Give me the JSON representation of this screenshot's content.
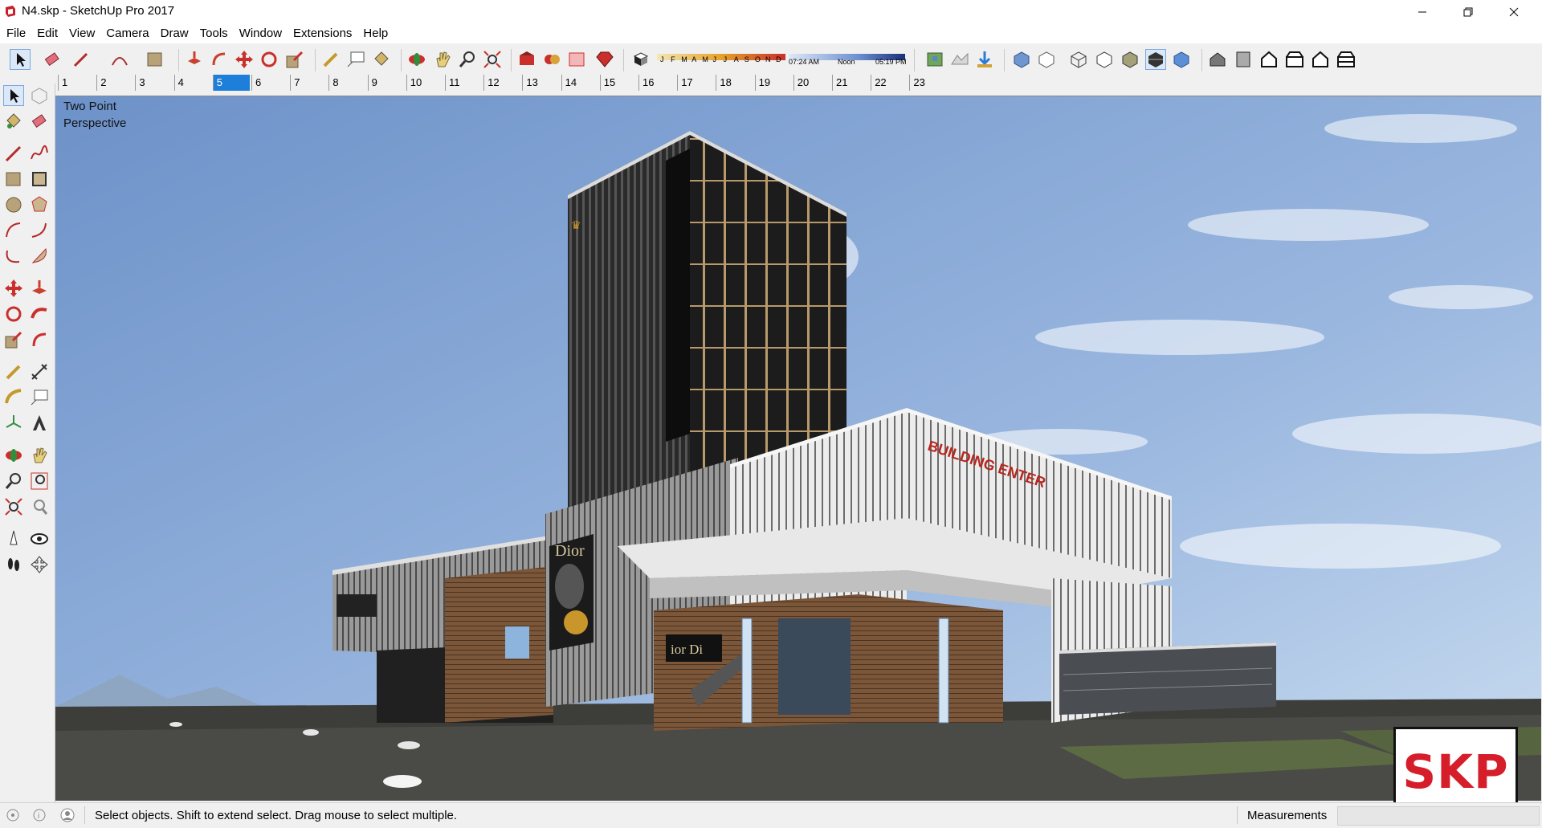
{
  "window": {
    "title": "N4.skp - SketchUp Pro 2017",
    "minimize_icon": "minimize-icon",
    "maximize_icon": "restore-icon",
    "close_icon": "close-icon"
  },
  "menu": [
    "File",
    "Edit",
    "View",
    "Camera",
    "Draw",
    "Tools",
    "Window",
    "Extensions",
    "Help"
  ],
  "shadow_settings": {
    "months": [
      "J",
      "F",
      "M",
      "A",
      "M",
      "J",
      "J",
      "A",
      "S",
      "O",
      "N",
      "D"
    ],
    "time_start": "07:24 AM",
    "time_mid": "Noon",
    "time_end": "05:19 PM"
  },
  "scene_tabs": [
    "1",
    "2",
    "3",
    "4",
    "5",
    "6",
    "7",
    "8",
    "9",
    "10",
    "11",
    "12",
    "13",
    "14",
    "15",
    "16",
    "17",
    "18",
    "19",
    "20",
    "21",
    "22",
    "23"
  ],
  "active_scene": "5",
  "viewport": {
    "camera_label_line1": "Two Point",
    "camera_label_line2": "Perspective",
    "building_signage": [
      "Dior",
      "BUILDING ENTER"
    ]
  },
  "status": {
    "hint": "Select objects. Shift to extend select. Drag mouse to select multiple.",
    "measurements_label": "Measurements",
    "measurements_value": ""
  },
  "badge": {
    "text": "SKP"
  },
  "colors": {
    "accent": "#1e7fdb",
    "brand_red": "#d61e2b"
  }
}
